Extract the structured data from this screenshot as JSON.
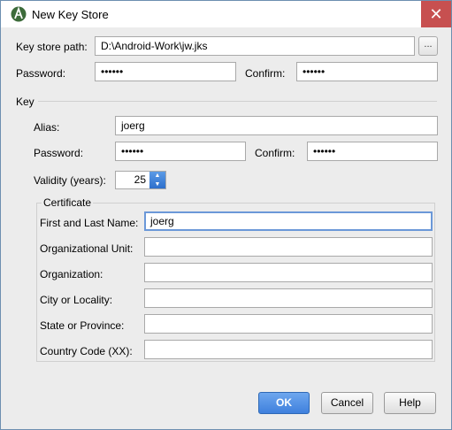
{
  "window": {
    "title": "New Key Store",
    "close_glyph": "✕",
    "accent_color": "#3f80dd",
    "close_color": "#c75050"
  },
  "keystore": {
    "path_label": "Key store path:",
    "path_value": "D:\\Android-Work\\jw.jks",
    "browse_label": "...",
    "password_label": "Password:",
    "password_value": "••••••",
    "confirm_label": "Confirm:",
    "confirm_value": "••••••"
  },
  "key": {
    "section_label": "Key",
    "alias_label": "Alias:",
    "alias_value": "joerg",
    "password_label": "Password:",
    "password_value": "••••••",
    "confirm_label": "Confirm:",
    "confirm_value": "••••••",
    "validity_label": "Validity (years):",
    "validity_value": "25"
  },
  "certificate": {
    "legend": "Certificate",
    "fields": [
      {
        "label": "First and Last Name:",
        "value": "joerg"
      },
      {
        "label": "Organizational Unit:",
        "value": ""
      },
      {
        "label": "Organization:",
        "value": ""
      },
      {
        "label": "City or Locality:",
        "value": ""
      },
      {
        "label": "State or Province:",
        "value": ""
      },
      {
        "label": "Country Code (XX):",
        "value": ""
      }
    ]
  },
  "buttons": {
    "ok": "OK",
    "cancel": "Cancel",
    "help": "Help"
  }
}
